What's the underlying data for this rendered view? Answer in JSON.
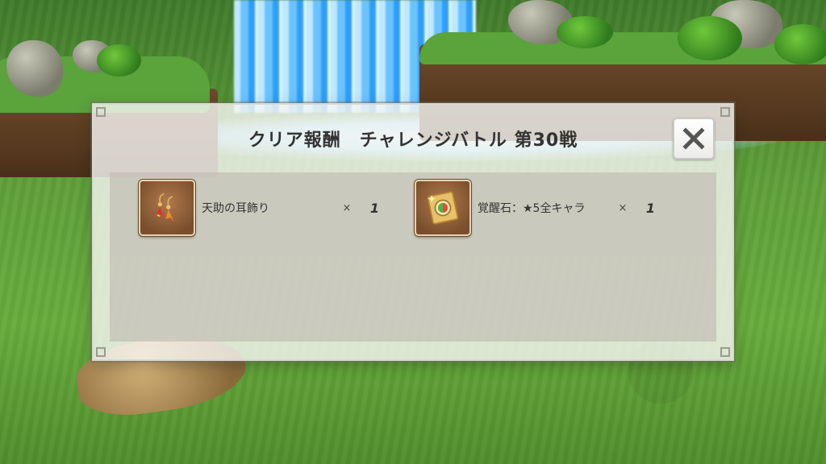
{
  "dialog": {
    "title": "クリア報酬　チャレンジバトル 第30戦",
    "close_icon": "close-x-icon"
  },
  "rewards": [
    {
      "name": "天助の耳飾り",
      "times": "×",
      "quantity": "1",
      "icon": "earrings-icon"
    },
    {
      "name": "覚醒石：★5全キャラ",
      "times": "×",
      "quantity": "1",
      "icon": "awakening-stone-icon"
    }
  ],
  "colors": {
    "dialog_bg": "#f5f5f2",
    "panel_bg": "#c4beb6",
    "title_text": "#333333",
    "item_frame": "#7a4e2c"
  }
}
